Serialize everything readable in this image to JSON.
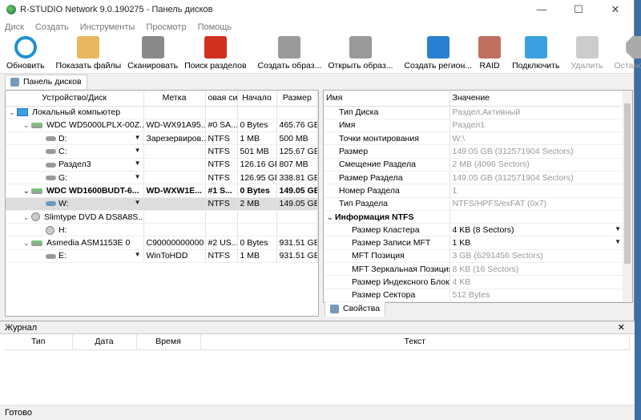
{
  "title": "R-STUDIO Network 9.0.190275 - Панель дисков",
  "window_controls": {
    "minimize": "—",
    "maximize": "☐",
    "close": "✕"
  },
  "menu": [
    "Диск",
    "Создать",
    "Инструменты",
    "Просмотр",
    "Помощь"
  ],
  "toolbar": [
    {
      "label": "Обновить",
      "icon": "refresh-icon",
      "color": "#1e90d8",
      "enabled": true
    },
    {
      "label": "Показать файлы",
      "icon": "folder-files-icon",
      "color": "#e8b860",
      "enabled": true
    },
    {
      "label": "Сканировать",
      "icon": "scan-icon",
      "color": "#8a8a8a",
      "enabled": true
    },
    {
      "label": "Поиск разделов",
      "icon": "find-partitions-icon",
      "color": "#d03020",
      "enabled": true
    },
    {
      "label": "Создать образ...",
      "icon": "create-image-icon",
      "color": "#9a9a9a",
      "enabled": true
    },
    {
      "label": "Открыть образ...",
      "icon": "open-image-icon",
      "color": "#9a9a9a",
      "enabled": true
    },
    {
      "label": "Создать регион...",
      "icon": "create-region-icon",
      "color": "#2a80d0",
      "enabled": true
    },
    {
      "label": "RAID",
      "icon": "raid-icon",
      "color": "#c07060",
      "enabled": true
    },
    {
      "label": "Подключить",
      "icon": "connect-icon",
      "color": "#3aa0e0",
      "enabled": true
    },
    {
      "label": "Удалить",
      "icon": "remove-icon",
      "color": "#cccccc",
      "enabled": false
    },
    {
      "label": "Остановить",
      "icon": "stop-icon",
      "color": "#aaaaaa",
      "enabled": false
    }
  ],
  "tab": "Панель дисков",
  "disk_table": {
    "columns": [
      "Устройство/Диск",
      "Метка",
      "овая си",
      "Начало",
      "Размер"
    ],
    "rows": [
      {
        "level": 0,
        "type": "pc",
        "name": "Локальный компьютер",
        "label": "",
        "fs": "",
        "start": "",
        "size": ""
      },
      {
        "level": 1,
        "type": "hdd",
        "name": "WDC WD5000LPLX-00Z...",
        "label": "WD-WX91A95...",
        "fs": "#0 SA...",
        "start": "0 Bytes",
        "size": "465.76 GB"
      },
      {
        "level": 2,
        "type": "part",
        "name": "D:",
        "label": "Зарезервиров...",
        "fs": "NTFS",
        "start": "1 MB",
        "size": "500 MB"
      },
      {
        "level": 2,
        "type": "part",
        "name": "C:",
        "label": "",
        "fs": "NTFS",
        "start": "501 MB",
        "size": "125.67 GB"
      },
      {
        "level": 2,
        "type": "part",
        "name": "Раздел3",
        "label": "",
        "fs": "NTFS",
        "start": "126.16 GB",
        "size": "807 MB"
      },
      {
        "level": 2,
        "type": "part",
        "name": "G:",
        "label": "",
        "fs": "NTFS",
        "start": "126.95 GB",
        "size": "338.81 GB"
      },
      {
        "level": 1,
        "type": "hdd",
        "name": "WDC WD1600BUDT-6...",
        "label": "WD-WXW1E...",
        "fs": "#1 S...",
        "start": "0 Bytes",
        "size": "149.05 GB",
        "bold": true
      },
      {
        "level": 2,
        "type": "part",
        "name": "W:",
        "label": "",
        "fs": "NTFS",
        "start": "2 MB",
        "size": "149.05 GB",
        "selected": true
      },
      {
        "level": 1,
        "type": "cd",
        "name": "Slimtype DVD A DS8A8S...",
        "label": "",
        "fs": "",
        "start": "",
        "size": ""
      },
      {
        "level": 2,
        "type": "cdpart",
        "name": "H:",
        "label": "",
        "fs": "",
        "start": "",
        "size": ""
      },
      {
        "level": 1,
        "type": "hdd",
        "name": "Asmedia ASM1153E 0",
        "label": "C90000000000",
        "fs": "#2 US...",
        "start": "0 Bytes",
        "size": "931.51 GB"
      },
      {
        "level": 2,
        "type": "part",
        "name": "E:",
        "label": "WinToHDD",
        "fs": "NTFS",
        "start": "1 MB",
        "size": "931.51 GB"
      }
    ]
  },
  "properties": {
    "columns": [
      "Имя",
      "Значение"
    ],
    "rows": [
      {
        "name": "Тип Диска",
        "value": "Раздел,Активный"
      },
      {
        "name": "Имя",
        "value": "Раздел1"
      },
      {
        "name": "Точки монтирования",
        "value": "W:\\"
      },
      {
        "name": "Размер",
        "value": "149.05 GB (312571904 Sectors)"
      },
      {
        "name": "Смещение Раздела",
        "value": "2 MB (4096 Sectors)"
      },
      {
        "name": "Размер Раздела",
        "value": "149.05 GB (312571904 Sectors)"
      },
      {
        "name": "Номер Раздела",
        "value": "1"
      },
      {
        "name": "Тип Раздела",
        "value": "NTFS/HPFS/exFAT (0x7)"
      },
      {
        "name": "Информация NTFS",
        "value": "",
        "group": true
      },
      {
        "name": "Размер Кластера",
        "value": "4 KB (8 Sectors)",
        "sub": true,
        "editable": true
      },
      {
        "name": "Размер Записи MFT",
        "value": "1 KB",
        "sub": true,
        "editable": true
      },
      {
        "name": "MFT Позиция",
        "value": "3 GB (6291456 Sectors)",
        "sub": true
      },
      {
        "name": "MFT Зеркальная Позиция",
        "value": "8 KB (16 Sectors)",
        "sub": true
      },
      {
        "name": "Размер Индексного Блока",
        "value": "4 KB",
        "sub": true
      },
      {
        "name": "Размер Сектора",
        "value": "512 Bytes",
        "sub": true
      }
    ],
    "tab": "Свойства"
  },
  "journal": {
    "title": "Журнал",
    "columns": [
      "Тип",
      "Дата",
      "Время",
      "Текст"
    ]
  },
  "status": "Готово"
}
